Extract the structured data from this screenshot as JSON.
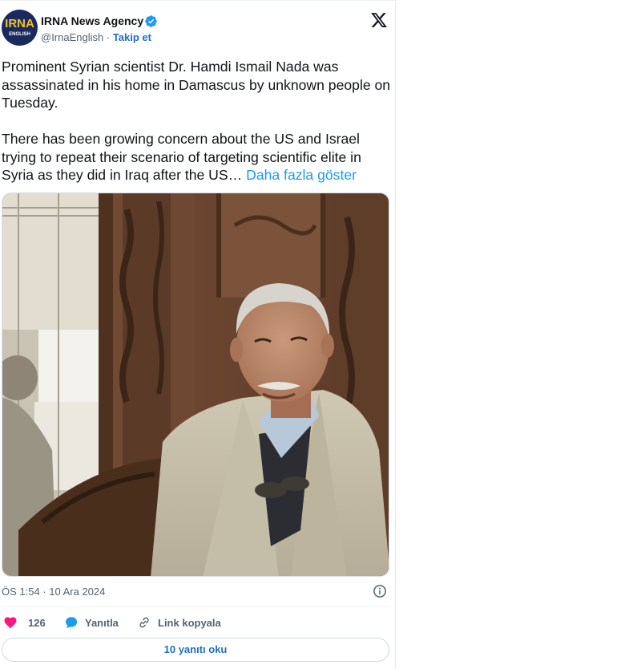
{
  "account": {
    "avatar_logo_text": "IRNA",
    "avatar_logo_sub": "ENGLISH",
    "display_name": "IRNA News Agency",
    "handle": "@IrnaEnglish",
    "separator": " · ",
    "follow_label": "Takip et"
  },
  "tweet": {
    "text": "Prominent Syrian scientist Dr. Hamdi Ismail Nada was assassinated in his home in Damascus by unknown people on Tuesday.\n\nThere has been growing concern about the US and Israel trying to repeat their scenario of targeting scientific elite in Syria as they did in Iraq after the US… ",
    "show_more_label": "Daha fazla göster",
    "timestamp": "ÖS 1:54 · 10 Ara 2024"
  },
  "actions": {
    "like_count": "126",
    "reply_label": "Yanıtla",
    "copy_link_label": "Link kopyala"
  },
  "read_replies_label": "10 yanıtı oku",
  "icons": {
    "avatar": "irna-logo",
    "verified": "verified-badge-icon",
    "brand": "x-logo-icon",
    "info": "info-icon",
    "like": "heart-icon",
    "reply": "speech-bubble-icon",
    "link": "link-icon"
  },
  "colors": {
    "accent_link": "#1d9bf0",
    "follow": "#1d6fbf",
    "like": "#f91880",
    "reply": "#1d9bf0",
    "verified": "#1d9bf0",
    "avatar_bg": "#1b2a5e",
    "avatar_text": "#f2c230"
  }
}
